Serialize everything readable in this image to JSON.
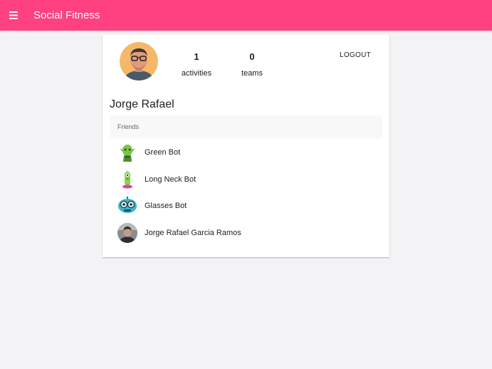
{
  "app": {
    "title": "Social Fitness",
    "accent_color": "#ff4081",
    "menu_icon": "hamburger-menu-icon"
  },
  "profile": {
    "name": "Jorge Rafael",
    "avatar_icon": "user-avatar-icon",
    "stats": [
      {
        "value": "1",
        "label": "activities"
      },
      {
        "value": "0",
        "label": "teams"
      }
    ],
    "logout_label": "LOGOUT"
  },
  "friends": {
    "header": "Friends",
    "items": [
      {
        "name": "Green Bot",
        "icon": "green-bot-avatar-icon"
      },
      {
        "name": "Long Neck Bot",
        "icon": "long-neck-bot-avatar-icon"
      },
      {
        "name": "Glasses Bot",
        "icon": "glasses-bot-avatar-icon"
      },
      {
        "name": "Jorge Rafael Garcia Ramos",
        "icon": "user-photo-avatar-icon"
      }
    ]
  }
}
